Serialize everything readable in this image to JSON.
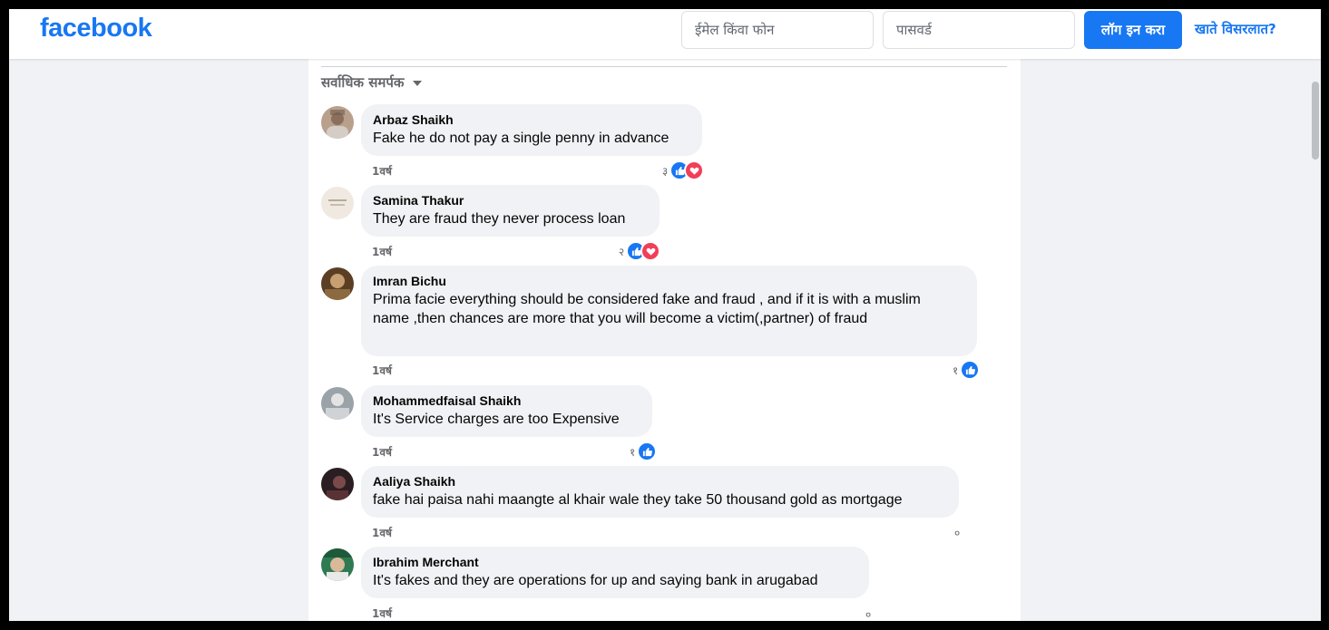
{
  "header": {
    "logo": "facebook",
    "email_placeholder": "ईमेल किंवा फोन",
    "password_placeholder": "पासवर्ड",
    "login_label": "लॉग इन करा",
    "forgot_label": "खाते विसरलात?"
  },
  "comments_section": {
    "sort_label": "सर्वाधिक समर्पक",
    "comments": [
      {
        "author": "Arbaz Shaikh",
        "text": "Fake he do not pay a single penny in advance",
        "time": "1वर्ष",
        "reaction_count": "३",
        "reactions": [
          "like",
          "love"
        ]
      },
      {
        "author": "Samina Thakur",
        "text": "They are fraud they never process loan",
        "time": "1वर्ष",
        "reaction_count": "२",
        "reactions": [
          "like",
          "love"
        ]
      },
      {
        "author": "Imran Bichu",
        "text": "Prima facie everything should be considered fake and fraud , and if it is with a muslim name ,then chances are more that you will become a victim(,partner) of fraud",
        "time": "1वर्ष",
        "reaction_count": "१",
        "reactions": [
          "like"
        ]
      },
      {
        "author": "Mohammedfaisal Shaikh",
        "text": "It's Service charges are too Expensive",
        "time": "1वर्ष",
        "reaction_count": "१",
        "reactions": [
          "like"
        ]
      },
      {
        "author": "Aaliya Shaikh",
        "text": "fake hai paisa nahi maangte al khair wale they take 50 thousand gold as mortgage",
        "time": "1वर्ष",
        "reaction_count": "०",
        "reactions": []
      },
      {
        "author": "Ibrahim Merchant",
        "text": "It's fakes and they are operations for up and saying bank in arugabad",
        "time": "1वर्ष",
        "reaction_count": "०",
        "reactions": []
      }
    ]
  },
  "icons": {
    "like": "thumbs-up-icon",
    "love": "heart-icon",
    "sort": "caret-down-icon"
  },
  "colors": {
    "brand": "#1877f2",
    "love": "#f33e58",
    "bubble": "#f0f2f5"
  }
}
